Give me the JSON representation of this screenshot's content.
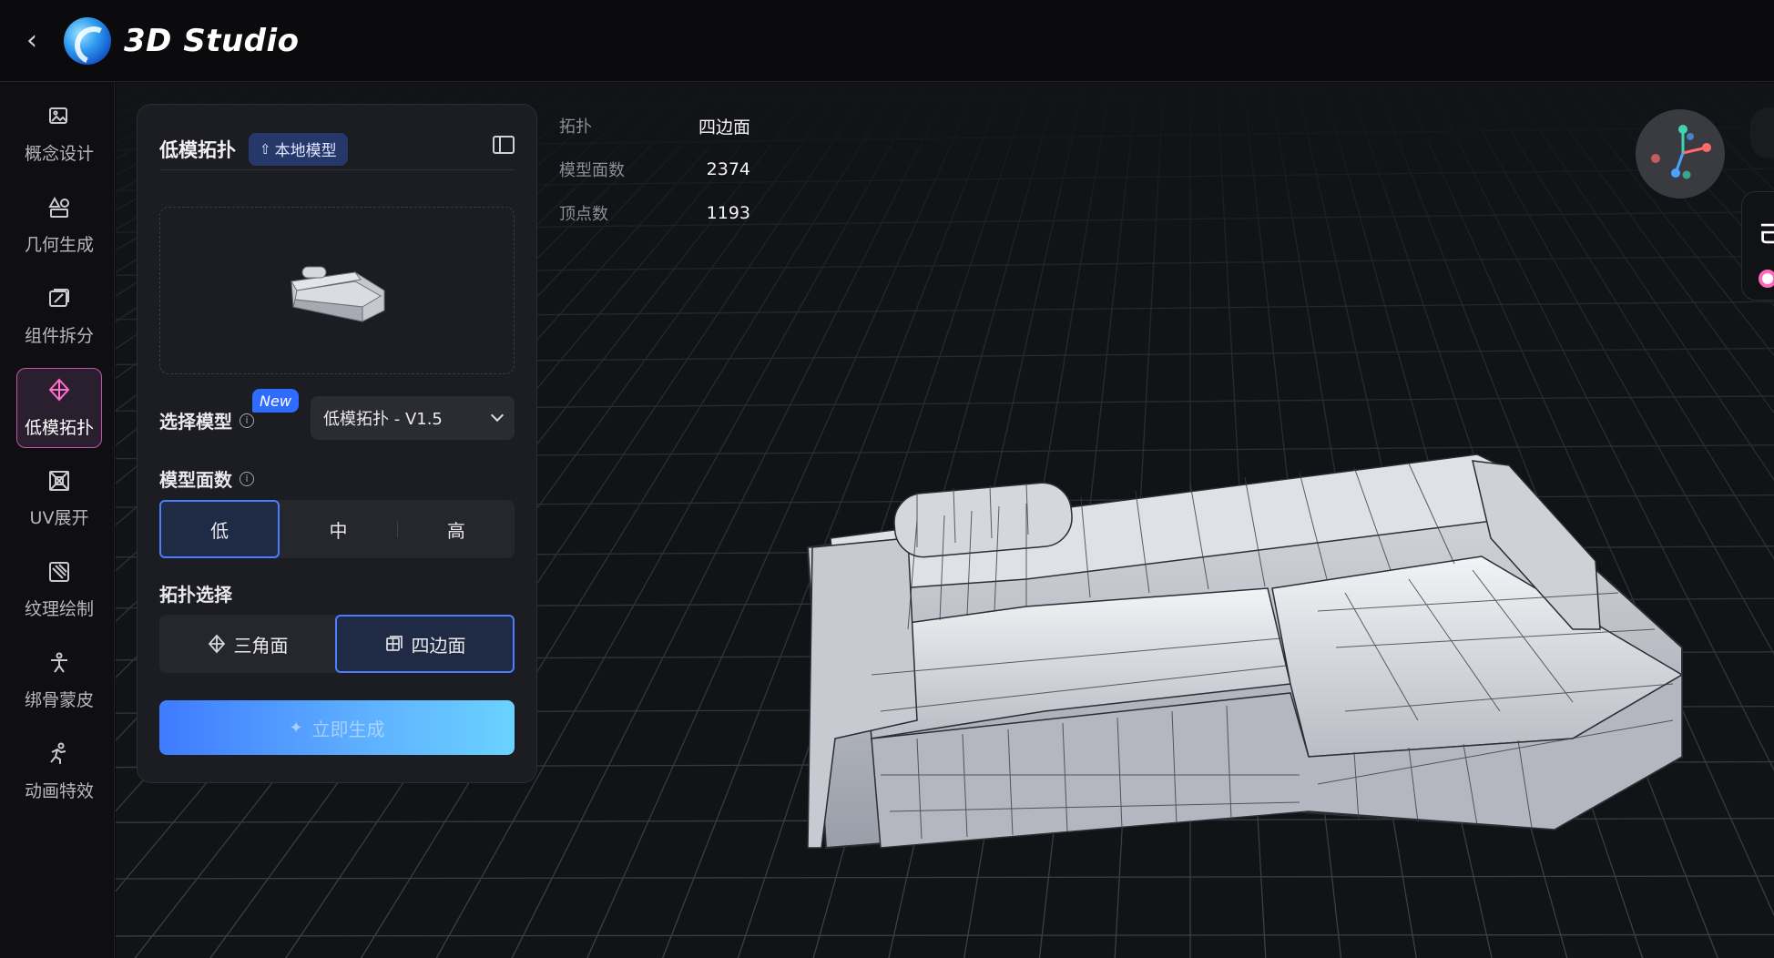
{
  "header": {
    "back_icon": "chevron-left-icon",
    "app_title": "3D Studio"
  },
  "sidebar": {
    "items": [
      {
        "label": "概念设计",
        "icon": "image-edit-icon"
      },
      {
        "label": "几何生成",
        "icon": "shapes-icon"
      },
      {
        "label": "组件拆分",
        "icon": "split-box-icon"
      },
      {
        "label": "低模拓扑",
        "icon": "topology-diamond-icon",
        "active": true
      },
      {
        "label": "UV展开",
        "icon": "uv-unwrap-icon"
      },
      {
        "label": "纹理绘制",
        "icon": "texture-paint-icon"
      },
      {
        "label": "绑骨蒙皮",
        "icon": "rigging-figure-icon"
      },
      {
        "label": "动画特效",
        "icon": "running-figure-icon"
      }
    ]
  },
  "panel": {
    "title": "低模拓扑",
    "local_model_button": "本地模型",
    "select_model_label": "选择模型",
    "new_badge": "New",
    "selected_model": "低模拓扑 - V1.5",
    "face_count_label": "模型面数",
    "face_options": [
      "低",
      "中",
      "高"
    ],
    "face_selected": "低",
    "topology_label": "拓扑选择",
    "topology_options": [
      "三角面",
      "四边面"
    ],
    "topology_selected": "四边面",
    "generate_button": "立即生成"
  },
  "stats": {
    "rows": [
      {
        "key": "拓扑",
        "value": "四边面"
      },
      {
        "key": "模型面数",
        "value": "2374"
      },
      {
        "key": "顶点数",
        "value": "1193"
      }
    ]
  },
  "colors": {
    "accent_pink": "#c455a8",
    "accent_blue": "#4d7dff",
    "badge_blue": "#2f6bff"
  }
}
